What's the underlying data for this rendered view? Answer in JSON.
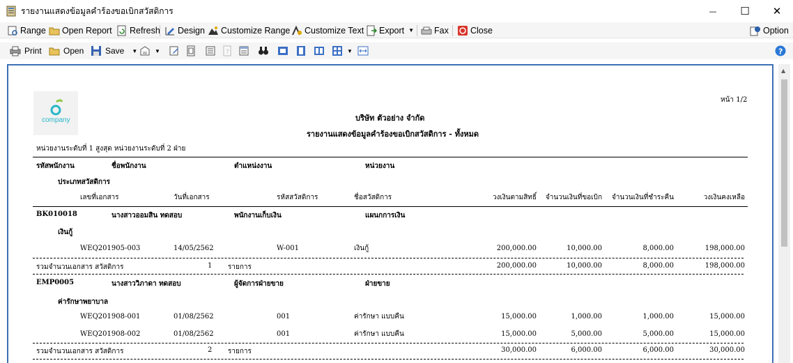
{
  "window": {
    "title": "รายงานแสดงข้อมูลคำร้องขอเบิกสวัสดิการ",
    "minimize_glyph": "—",
    "maximize_glyph": "☐",
    "close_glyph": "✕"
  },
  "toolbar": {
    "range": "Range",
    "open_report": "Open Report",
    "refresh": "Refresh",
    "design": "Design",
    "customize_range": "Customize Range",
    "customize_text": "Customize Text",
    "export": "Export",
    "fax": "Fax",
    "close": "Close",
    "option": "Option"
  },
  "preview_toolbar": {
    "print": "Print",
    "open": "Open",
    "save": "Save"
  },
  "report": {
    "logo_text": "company",
    "page_label": "หน้า 1/2",
    "company_name": "บริษัท ตัวอย่าง จำกัด",
    "report_title": "รายงานแสดงข้อมูลคำร้องขอเบิกสวัสดิการ - ทั้งหมด",
    "filter_text": "หน่วยงานระดับที่ 1 สูงสุด หน่วยงานระดับที่ 2 ฝ่าย",
    "headers": {
      "emp_code": "รหัสพนักงาน",
      "emp_name": "ชื่อพนักงาน",
      "position": "ตำแหน่งงาน",
      "department": "หน่วยงาน",
      "welfare_type": "ประเภทสวัสดิการ",
      "doc_no": "เลขที่เอกสาร",
      "doc_date": "วันที่เอกสาร",
      "welfare_code": "รหัสสวัสดิการ",
      "welfare_name": "ชื่อสวัสดิการ",
      "entitled": "วงเงินตามสิทธิ์",
      "requested": "จำนวนเงินที่ขอเบิก",
      "repaid": "จำนวนเงินที่ชำระคืน",
      "remaining": "วงเงินคงเหลือ"
    },
    "employees": [
      {
        "code": "BK010018",
        "name": "นางสาวออมสิน ทดสอบ",
        "position": "พนักงานเก็บเงิน",
        "department": "แผนกการเงิน",
        "type": "เงินกู้",
        "rows": [
          {
            "doc_no": "WEQ201905-003",
            "date": "14/05/2562",
            "welfare_code": "W-001",
            "welfare_name": "เงินกู้",
            "entitled": "200,000.00",
            "requested": "10,000.00",
            "repaid": "8,000.00",
            "remaining": "198,000.00"
          }
        ],
        "summary": {
          "label": "รวมจำนวนเอกสาร สวัสดิการ",
          "count": "1",
          "unit": "รายการ",
          "entitled": "200,000.00",
          "requested": "10,000.00",
          "repaid": "8,000.00",
          "remaining": "198,000.00"
        }
      },
      {
        "code": "EMP0005",
        "name": "นางสาววิภาดา ทดสอบ",
        "position": "ผู้จัดการฝ่ายขาย",
        "department": "ฝ่ายขาย",
        "type": "ค่ารักษาพยาบาล",
        "rows": [
          {
            "doc_no": "WEQ201908-001",
            "date": "01/08/2562",
            "welfare_code": "001",
            "welfare_name": "ค่ารักษา แบบคืน",
            "entitled": "15,000.00",
            "requested": "1,000.00",
            "repaid": "1,000.00",
            "remaining": "15,000.00"
          },
          {
            "doc_no": "WEQ201908-002",
            "date": "01/08/2562",
            "welfare_code": "001",
            "welfare_name": "ค่ารักษา แบบคืน",
            "entitled": "15,000.00",
            "requested": "5,000.00",
            "repaid": "5,000.00",
            "remaining": "15,000.00"
          }
        ],
        "summary": {
          "label": "รวมจำนวนเอกสาร สวัสดิการ",
          "count": "2",
          "unit": "รายการ",
          "entitled": "30,000.00",
          "requested": "6,000.00",
          "repaid": "6,000.00",
          "remaining": "30,000.00"
        }
      }
    ]
  }
}
